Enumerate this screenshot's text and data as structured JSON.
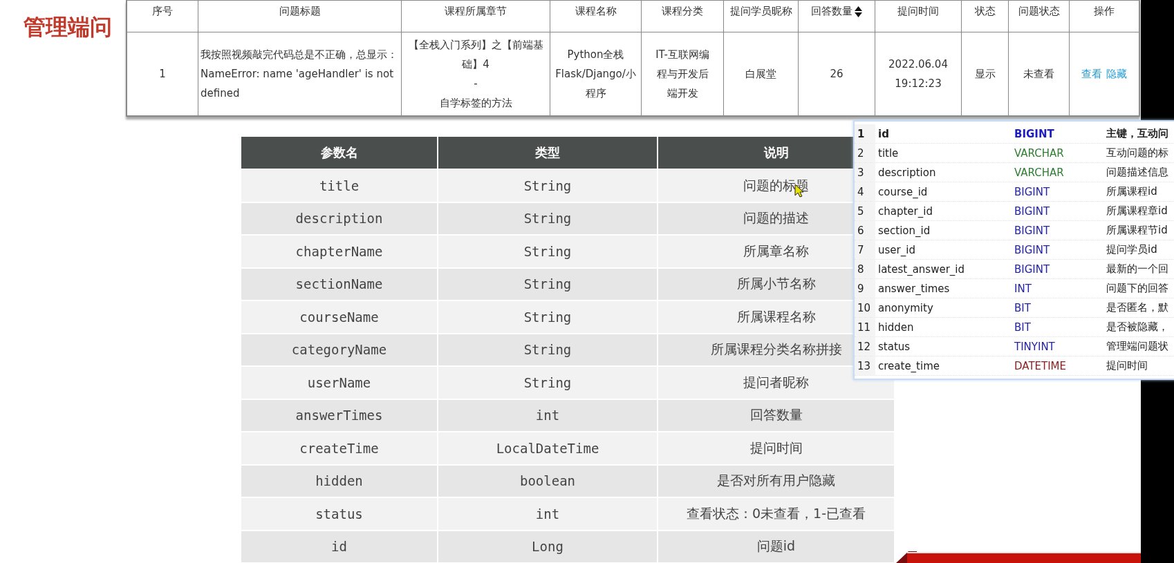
{
  "page_title": "管理端问",
  "question_table": {
    "columns": [
      {
        "label": "序号",
        "sortable": false
      },
      {
        "label": "问题标题",
        "sortable": false
      },
      {
        "label": "课程所属章节",
        "sortable": false
      },
      {
        "label": "课程名称",
        "sortable": false
      },
      {
        "label": "课程分类",
        "sortable": false
      },
      {
        "label": "提问学员昵称",
        "sortable": false
      },
      {
        "label": "回答数量",
        "sortable": true
      },
      {
        "label": "提问时间",
        "sortable": false
      },
      {
        "label": "状态",
        "sortable": false
      },
      {
        "label": "问题状态",
        "sortable": false
      },
      {
        "label": "操作",
        "sortable": false
      }
    ],
    "rows": [
      {
        "cells": [
          "1",
          "我按照视频敲完代码总是不正确，总显示：  NameError: name 'ageHandler' is not defined",
          "【全栈入门系列】之【前端基础】4\n-\n自学标签的方法",
          "Python全栈Flask/Django/小程序",
          "IT-互联网编程与开发后端开发",
          "白展堂",
          "26",
          "2022.06.04\n19:12:23",
          "显示",
          "未查看"
        ],
        "actions": [
          "查看",
          "隐藏"
        ]
      }
    ]
  },
  "param_table": {
    "columns": [
      "参数名",
      "类型",
      "说明"
    ],
    "rows": [
      [
        "title",
        "String",
        "问题的标题"
      ],
      [
        "description",
        "String",
        "问题的描述"
      ],
      [
        "chapterName",
        "String",
        "所属章名称"
      ],
      [
        "sectionName",
        "String",
        "所属小节名称"
      ],
      [
        "courseName",
        "String",
        "所属课程名称"
      ],
      [
        "categoryName",
        "String",
        "所属课程分类名称拼接"
      ],
      [
        "userName",
        "String",
        "提问者昵称"
      ],
      [
        "answerTimes",
        "int",
        "回答数量"
      ],
      [
        "createTime",
        "LocalDateTime",
        "提问时间"
      ],
      [
        "hidden",
        "boolean",
        "是否对所有用户隐藏"
      ],
      [
        "status",
        "int",
        "查看状态：0未查看，1-已查看"
      ],
      [
        "id",
        "Long",
        "问题id"
      ]
    ]
  },
  "db_table": {
    "rows": [
      {
        "number": "1",
        "name": "id",
        "type": "BIGINT",
        "color": "#1c1cc4",
        "comment": "主键，互动问",
        "selected": true
      },
      {
        "number": "2",
        "name": "title",
        "type": "VARCHAR",
        "color": "#2e7d32",
        "comment": "互动问题的标",
        "selected": false
      },
      {
        "number": "3",
        "name": "description",
        "type": "VARCHAR",
        "color": "#2e7d32",
        "comment": "问题描述信息",
        "selected": false
      },
      {
        "number": "4",
        "name": "course_id",
        "type": "BIGINT",
        "color": "#2323a8",
        "comment": "所属课程id",
        "selected": false
      },
      {
        "number": "5",
        "name": "chapter_id",
        "type": "BIGINT",
        "color": "#2323a8",
        "comment": "所属课程章id",
        "selected": false
      },
      {
        "number": "6",
        "name": "section_id",
        "type": "BIGINT",
        "color": "#2323a8",
        "comment": "所属课程节id",
        "selected": false
      },
      {
        "number": "7",
        "name": "user_id",
        "type": "BIGINT",
        "color": "#2323a8",
        "comment": "提问学员id",
        "selected": false
      },
      {
        "number": "8",
        "name": "latest_answer_id",
        "type": "BIGINT",
        "color": "#2323a8",
        "comment": "最新的一个回",
        "selected": false
      },
      {
        "number": "9",
        "name": "answer_times",
        "type": "INT",
        "color": "#2323a8",
        "comment": "问题下的回答",
        "selected": false
      },
      {
        "number": "10",
        "name": "anonymity",
        "type": "BIT",
        "color": "#2323a8",
        "comment": "是否匿名，默",
        "selected": false
      },
      {
        "number": "11",
        "name": "hidden",
        "type": "BIT",
        "color": "#2323a8",
        "comment": "是否被隐藏，",
        "selected": false
      },
      {
        "number": "12",
        "name": "status",
        "type": "TINYINT",
        "color": "#2323a8",
        "comment": "管理端问题状",
        "selected": false
      },
      {
        "number": "13",
        "name": "create_time",
        "type": "DATETIME",
        "color": "#8b1e1e",
        "comment": "提问时间",
        "selected": false
      }
    ]
  }
}
